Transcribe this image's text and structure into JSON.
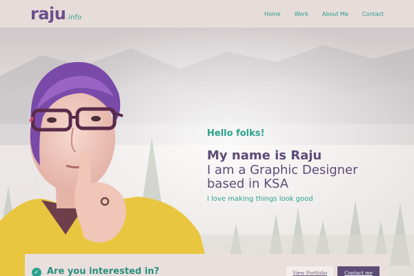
{
  "header": {
    "logo_main": "raju",
    "logo_tld": ".info",
    "nav": [
      {
        "label": "Home"
      },
      {
        "label": "Work"
      },
      {
        "label": "About Me"
      },
      {
        "label": "Contact"
      }
    ]
  },
  "hero": {
    "greeting": "Hello folks!",
    "name": "My name is Raju",
    "role_line1": "I am a Graphic Designer",
    "role_line2": "based in KSA",
    "tagline": "I love making things look good"
  },
  "cta": {
    "title": "Are you interested in?",
    "portfolio_label": "View Portfolio",
    "contact_label": "Contact me"
  },
  "colors": {
    "accent_teal": "#2aa38e",
    "brand_purple": "#5d4b78",
    "header_bg": "#e6dcda"
  }
}
